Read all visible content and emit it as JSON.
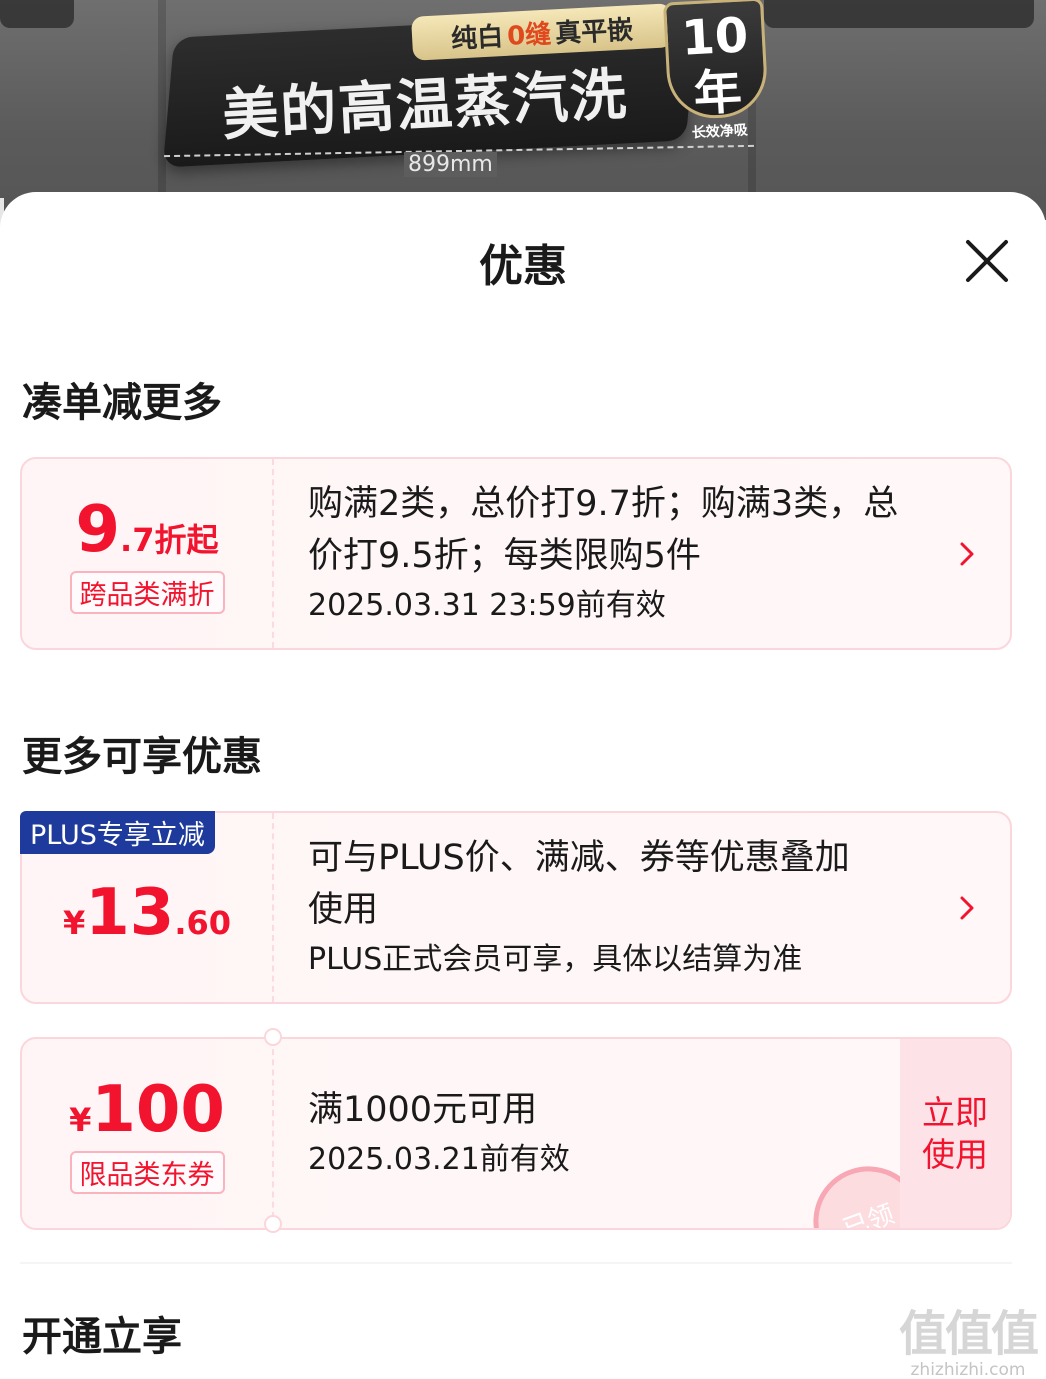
{
  "banner": {
    "label_top": [
      "纯白",
      "0缝",
      "真平嵌"
    ],
    "label_main": "美的高温蒸汽洗",
    "badge_big": "10年",
    "badge_small": "长效净吸",
    "measure": "899mm"
  },
  "sheet": {
    "title": "优惠",
    "close_icon": "close-icon"
  },
  "section1": {
    "title": "凑单减更多",
    "card": {
      "amount_int": "9",
      "amount_suffix": ".7折起",
      "tag": "跨品类满折",
      "desc_line1": "购满2类，总价打9.7折；购满3类，总",
      "desc_line2": "价打9.5折；每类限购5件",
      "validity": "2025.03.31 23:59前有效"
    }
  },
  "section2": {
    "title": "更多可享优惠",
    "plus_card": {
      "tag": "PLUS专享立减",
      "currency": "¥",
      "amount_int": "13",
      "amount_dec": ".60",
      "desc_line1": "可与PLUS价、满减、券等优惠叠加",
      "desc_line2": "使用",
      "note": "PLUS正式会员可享，具体以结算为准"
    },
    "coupon_card": {
      "currency": "¥",
      "amount": "100",
      "tag": "限品类东券",
      "condition": "满1000元可用",
      "validity": "2025.03.21前有效",
      "button_line1": "立即",
      "button_line2": "使用",
      "stamp": "已领"
    }
  },
  "section3": {
    "title": "开通立享"
  },
  "watermark": {
    "logo": "值值值",
    "url": "zhizhizhi.com"
  },
  "colors": {
    "accent_red": "#f2142e",
    "plus_blue": "#1d3a9c",
    "card_border": "#fbd6dc"
  }
}
